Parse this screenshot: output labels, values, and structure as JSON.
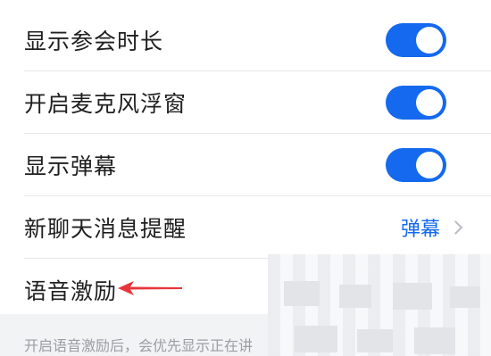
{
  "settings": {
    "items": [
      {
        "label": "显示参会时长",
        "control": "toggle",
        "on": true
      },
      {
        "label": "开启麦克风浮窗",
        "control": "toggle",
        "on": true
      },
      {
        "label": "显示弹幕",
        "control": "toggle",
        "on": true
      },
      {
        "label": "新聊天消息提醒",
        "control": "select",
        "value": "弹幕",
        "icon": "chevron-right-icon"
      },
      {
        "label": "语音激励",
        "control": "toggle",
        "on": true
      }
    ]
  },
  "footer": {
    "text": "开启语音激励后，会优先显示正在讲"
  },
  "colors": {
    "accent": "#1469ee",
    "annotation": "#e8353b",
    "text": "#1f1f1f",
    "muted": "#9a9da4"
  }
}
